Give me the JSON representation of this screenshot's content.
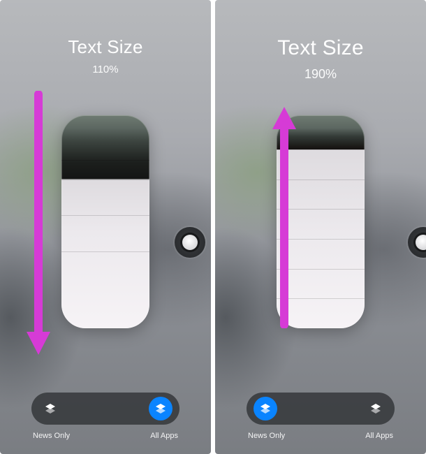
{
  "left": {
    "title": "Text Size",
    "percent": "110%",
    "toggle": {
      "news_label": "News Only",
      "all_label": "All Apps",
      "active": "all"
    }
  },
  "right": {
    "title": "Text Size",
    "percent": "190%",
    "toggle": {
      "news_label": "News Only",
      "all_label": "All Apps",
      "active": "news"
    }
  },
  "colors": {
    "accent": "#0a84ff",
    "annotation": "#d63bd6"
  }
}
